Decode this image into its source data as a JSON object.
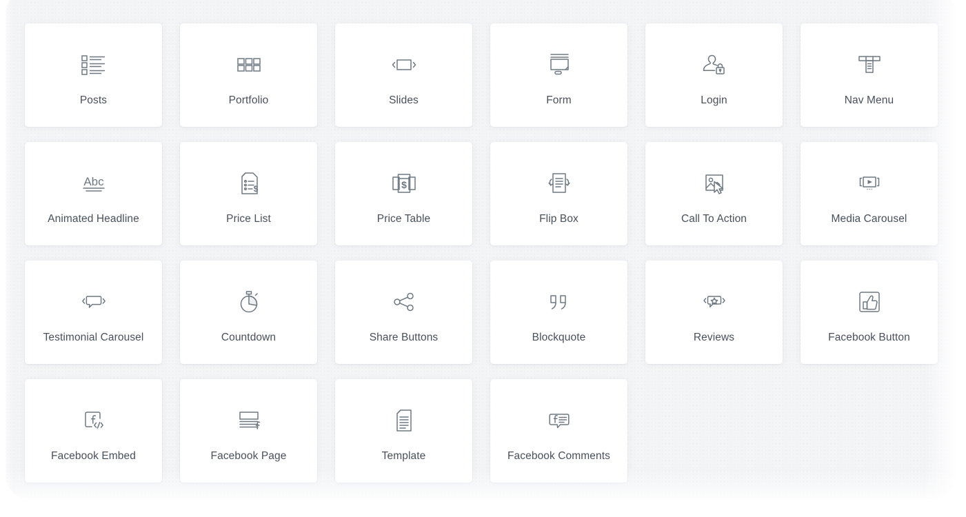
{
  "palette": {
    "page_background": "#ffffff",
    "panel_background": "#f3f4f6",
    "card_background": "#ffffff",
    "icon_stroke": "#6d7882",
    "label_text": "#48505c"
  },
  "widget_panel": {
    "columns": 6,
    "total_widgets": 22,
    "widgets": [
      {
        "label": "Posts",
        "icon": "posts-list-icon"
      },
      {
        "label": "Portfolio",
        "icon": "portfolio-grid-icon"
      },
      {
        "label": "Slides",
        "icon": "slides-carousel-icon"
      },
      {
        "label": "Form",
        "icon": "form-monitor-icon"
      },
      {
        "label": "Login",
        "icon": "login-user-lock-icon"
      },
      {
        "label": "Nav Menu",
        "icon": "nav-menu-dropdown-icon"
      },
      {
        "label": "Animated Headline",
        "icon": "animated-headline-abc-icon"
      },
      {
        "label": "Price List",
        "icon": "price-list-document-icon"
      },
      {
        "label": "Price Table",
        "icon": "price-table-dollar-icon"
      },
      {
        "label": "Flip Box",
        "icon": "flip-box-rotate-icon"
      },
      {
        "label": "Call To Action",
        "icon": "call-to-action-image-cursor-icon"
      },
      {
        "label": "Media Carousel",
        "icon": "media-carousel-play-icon"
      },
      {
        "label": "Testimonial Carousel",
        "icon": "testimonial-carousel-speech-icon"
      },
      {
        "label": "Countdown",
        "icon": "countdown-stopwatch-icon"
      },
      {
        "label": "Share Buttons",
        "icon": "share-nodes-icon"
      },
      {
        "label": "Blockquote",
        "icon": "blockquote-quotes-icon"
      },
      {
        "label": "Reviews",
        "icon": "reviews-star-speech-icon"
      },
      {
        "label": "Facebook Button",
        "icon": "facebook-thumbs-up-icon"
      },
      {
        "label": "Facebook Embed",
        "icon": "facebook-embed-code-icon"
      },
      {
        "label": "Facebook Page",
        "icon": "facebook-page-icon"
      },
      {
        "label": "Template",
        "icon": "template-document-icon"
      },
      {
        "label": "Facebook Comments",
        "icon": "facebook-comments-icon"
      }
    ]
  }
}
